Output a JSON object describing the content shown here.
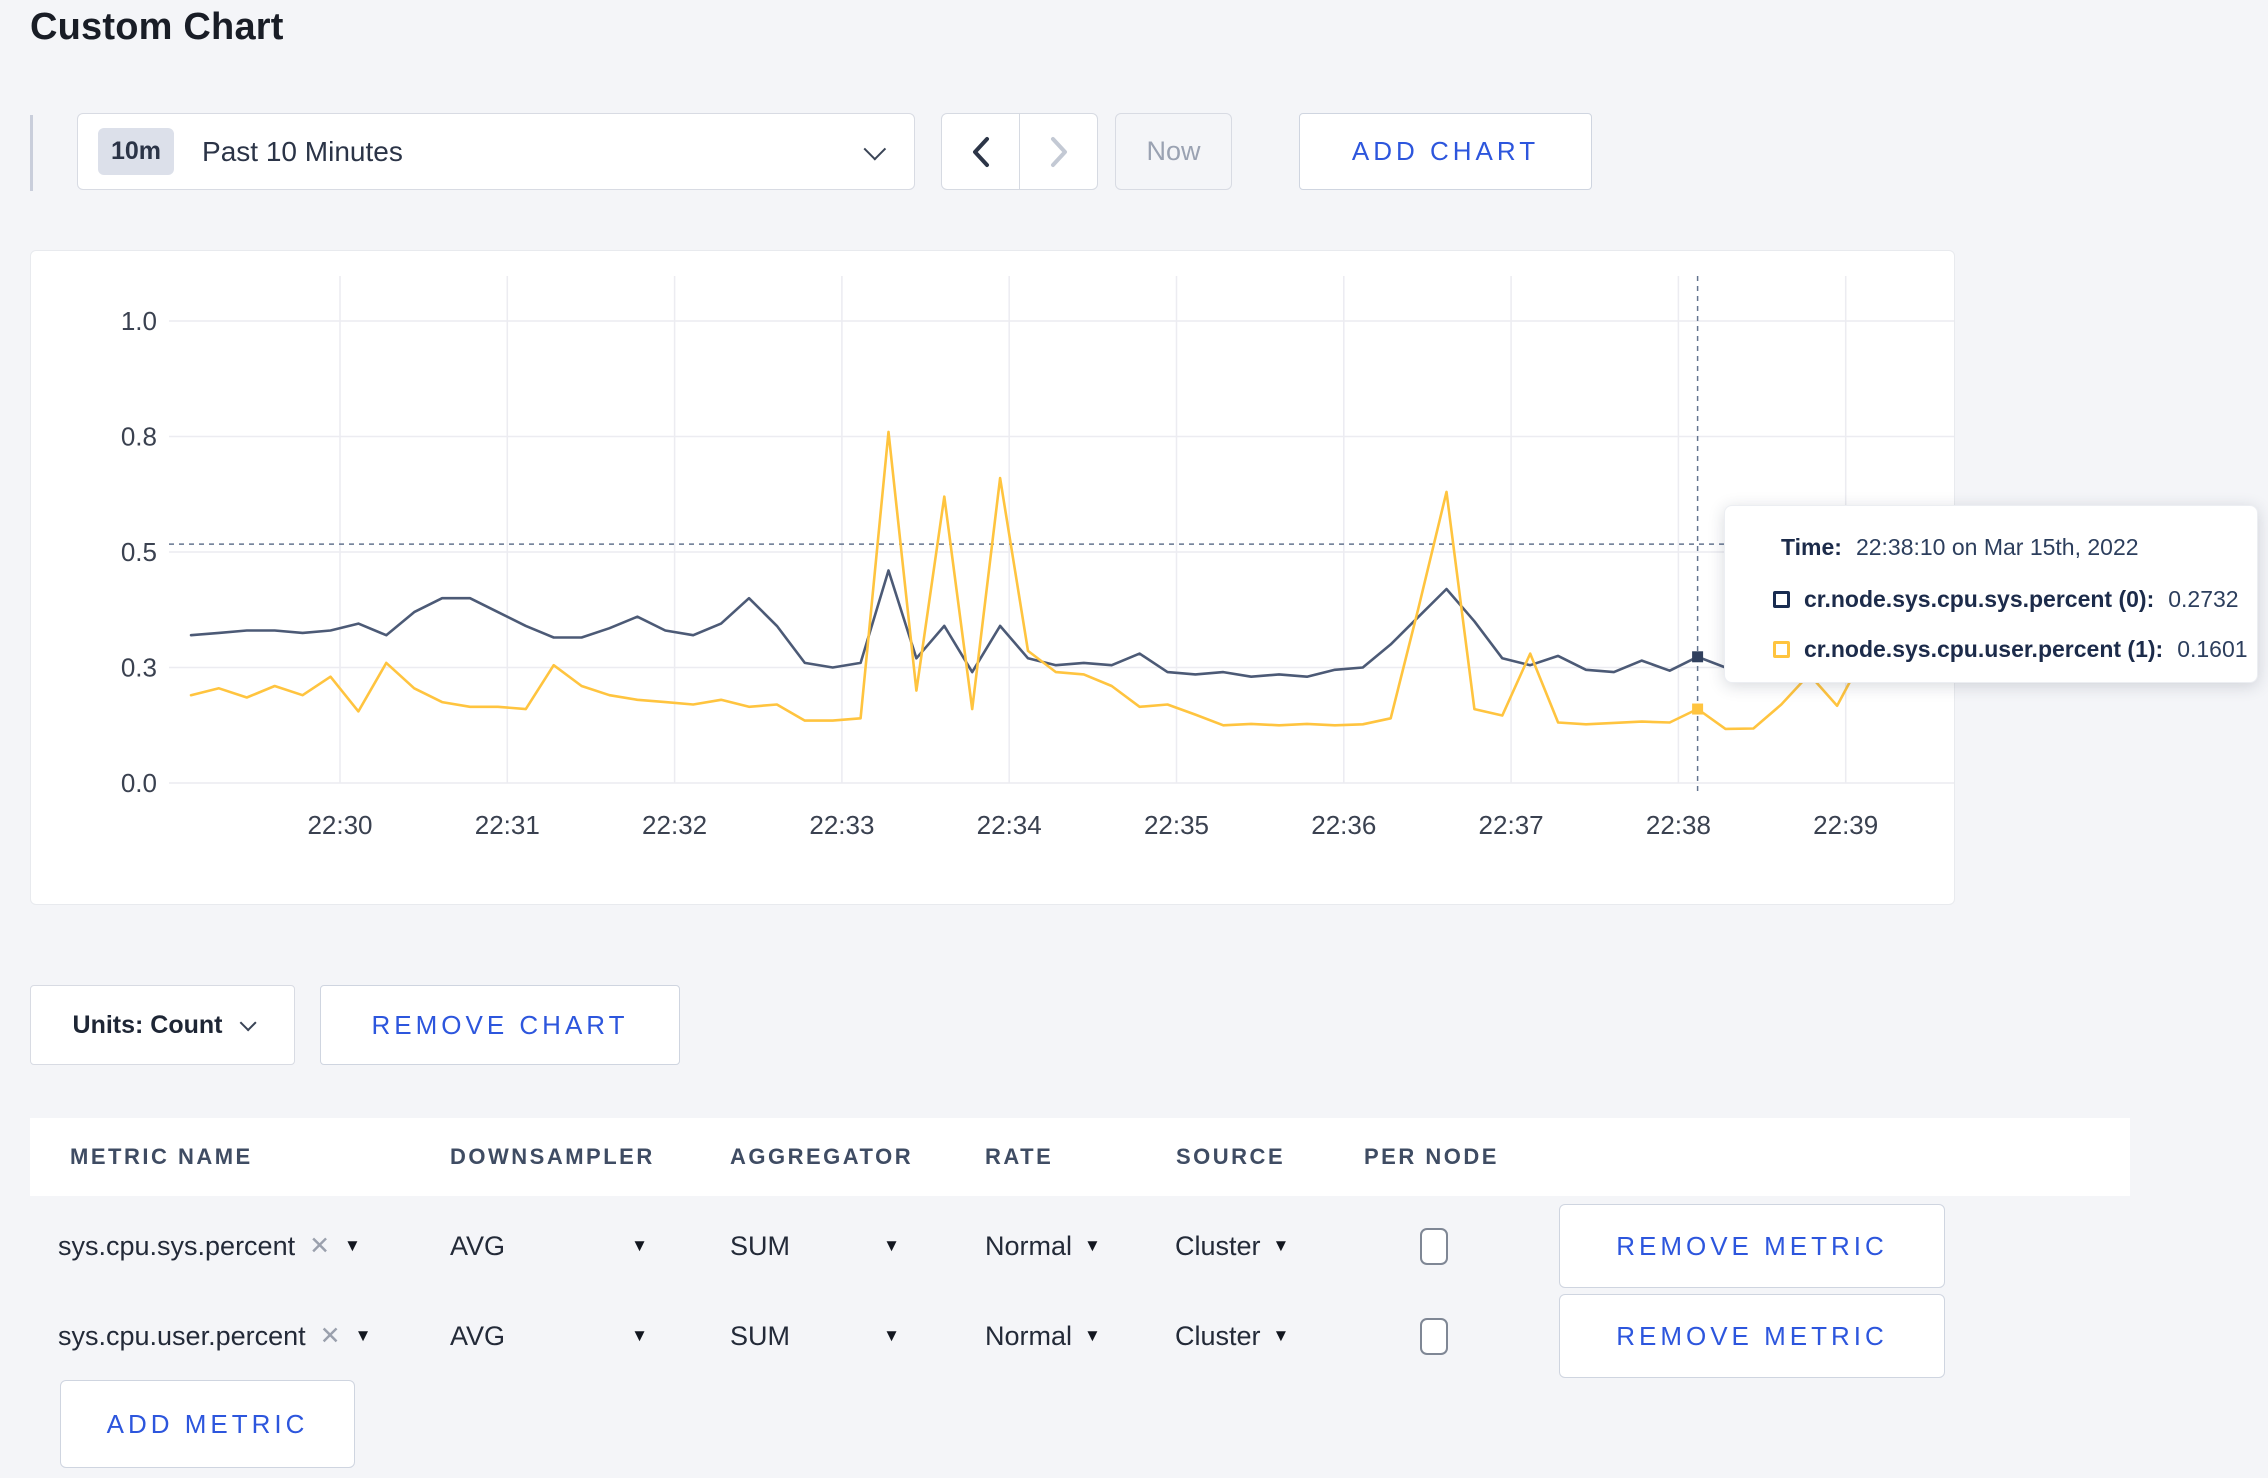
{
  "page": {
    "title": "Custom Chart"
  },
  "toolbar": {
    "time_range": {
      "badge": "10m",
      "label": "Past 10 Minutes"
    },
    "now_label": "Now",
    "add_chart_label": "ADD CHART"
  },
  "controls": {
    "units_label": "Units: Count",
    "remove_chart_label": "REMOVE CHART",
    "add_metric_label": "ADD METRIC"
  },
  "tooltip": {
    "time_label": "Time:",
    "time_value": "22:38:10 on Mar 15th, 2022",
    "entries": [
      {
        "label": "cr.node.sys.cpu.sys.percent (0):",
        "value": "0.2732",
        "color": "#192c51"
      },
      {
        "label": "cr.node.sys.cpu.user.percent (1):",
        "value": "0.1601",
        "color": "#ffc43f"
      }
    ]
  },
  "chart_data": {
    "type": "line",
    "title": "",
    "xlabel": "",
    "ylabel": "",
    "ylim": [
      0,
      1.0
    ],
    "grid": true,
    "legend_position": "tooltip-overlay",
    "x_start": "22:29:10",
    "x_end": "22:39:10",
    "interval_seconds": 10,
    "x_ticks": [
      "22:30",
      "22:31",
      "22:32",
      "22:33",
      "22:34",
      "22:35",
      "22:36",
      "22:37",
      "22:38",
      "22:39"
    ],
    "y_ticks": [
      {
        "label": "0.0",
        "value": 0
      },
      {
        "label": "0.3",
        "value": 0.25
      },
      {
        "label": "0.5",
        "value": 0.5
      },
      {
        "label": "0.8",
        "value": 0.75
      },
      {
        "label": "1.0",
        "value": 1.0
      }
    ],
    "gridline_color": "#ececf1",
    "axis_label_color": "#3a4150",
    "crosshair": {
      "time": "22:38:10",
      "x_index": 54,
      "hover_line_value": 0.517,
      "color": "#64748f"
    },
    "series": [
      {
        "name": "cr.node.sys.cpu.sys.percent (0)",
        "color": "#4c5a76",
        "marker_color": "#31405e",
        "values": [
          0.32,
          0.325,
          0.33,
          0.33,
          0.325,
          0.33,
          0.345,
          0.32,
          0.37,
          0.4,
          0.4,
          0.37,
          0.34,
          0.315,
          0.315,
          0.335,
          0.36,
          0.33,
          0.32,
          0.345,
          0.4,
          0.34,
          0.26,
          0.25,
          0.26,
          0.46,
          0.27,
          0.34,
          0.24,
          0.34,
          0.27,
          0.255,
          0.26,
          0.255,
          0.28,
          0.24,
          0.235,
          0.24,
          0.23,
          0.235,
          0.23,
          0.245,
          0.25,
          0.3,
          0.36,
          0.42,
          0.35,
          0.27,
          0.255,
          0.275,
          0.245,
          0.24,
          0.265,
          0.243,
          0.2732,
          0.25,
          0.255,
          0.27,
          0.29,
          0.3,
          0.3
        ]
      },
      {
        "name": "cr.node.sys.cpu.user.percent (1)",
        "color": "#ffc43f",
        "marker_color": "#ffc43f",
        "values": [
          0.19,
          0.205,
          0.185,
          0.21,
          0.19,
          0.23,
          0.155,
          0.26,
          0.205,
          0.175,
          0.165,
          0.165,
          0.16,
          0.255,
          0.21,
          0.19,
          0.18,
          0.175,
          0.17,
          0.18,
          0.165,
          0.17,
          0.135,
          0.135,
          0.14,
          0.76,
          0.2,
          0.62,
          0.16,
          0.66,
          0.286,
          0.24,
          0.235,
          0.21,
          0.165,
          0.17,
          0.148,
          0.125,
          0.128,
          0.125,
          0.128,
          0.125,
          0.127,
          0.14,
          0.38,
          0.63,
          0.16,
          0.146,
          0.28,
          0.131,
          0.127,
          0.13,
          0.133,
          0.131,
          0.1601,
          0.117,
          0.118,
          0.17,
          0.235,
          0.167,
          0.28
        ]
      }
    ]
  },
  "metrics_table": {
    "columns": [
      "METRIC NAME",
      "DOWNSAMPLER",
      "AGGREGATOR",
      "RATE",
      "SOURCE",
      "PER NODE"
    ],
    "remove_metric_label": "REMOVE METRIC",
    "rows": [
      {
        "metric": "sys.cpu.sys.percent",
        "downsampler": "AVG",
        "aggregator": "SUM",
        "rate": "Normal",
        "source": "Cluster",
        "per_node_checked": false
      },
      {
        "metric": "sys.cpu.user.percent",
        "downsampler": "AVG",
        "aggregator": "SUM",
        "rate": "Normal",
        "source": "Cluster",
        "per_node_checked": false
      }
    ]
  }
}
